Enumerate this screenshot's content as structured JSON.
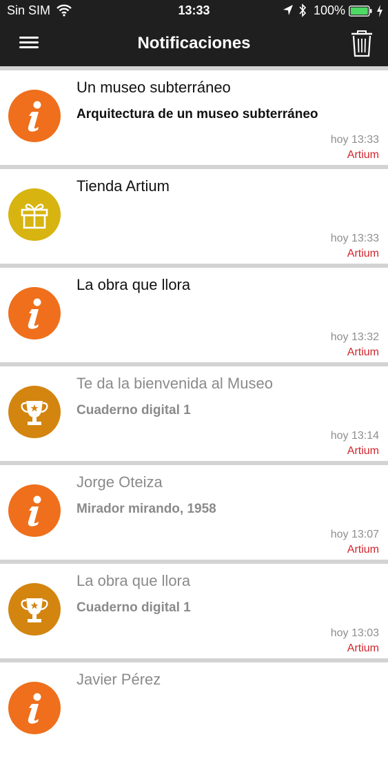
{
  "status_bar": {
    "carrier": "Sin SIM",
    "time": "13:33",
    "battery": "100%"
  },
  "nav_bar": {
    "title": "Notificaciones",
    "menu_icon": "hamburger-menu-icon",
    "trash_icon": "trash-icon"
  },
  "colors": {
    "bar_background": "#1f1f1f",
    "info_orange": "#ef6f1c",
    "gift_yellow": "#d7b40f",
    "trophy_gold": "#d3850f",
    "source_red": "#d0262c",
    "separator": "#d3d3d3"
  },
  "notifications": [
    {
      "icon": "info-icon",
      "title": "Un museo subterráneo",
      "subtitle": "Arquitectura de un museo subterráneo",
      "time": "hoy 13:33",
      "source": "Artium",
      "read": false
    },
    {
      "icon": "gift-icon",
      "title": "Tienda Artium",
      "subtitle": "",
      "time": "hoy 13:33",
      "source": "Artium",
      "read": false
    },
    {
      "icon": "info-icon",
      "title": "La obra que llora",
      "subtitle": "",
      "time": "hoy 13:32",
      "source": "Artium",
      "read": false
    },
    {
      "icon": "trophy-icon",
      "title": "Te da la bienvenida al Museo",
      "subtitle": "Cuaderno digital 1",
      "time": "hoy 13:14",
      "source": "Artium",
      "read": true
    },
    {
      "icon": "info-icon",
      "title": "Jorge Oteiza",
      "subtitle": "Mirador mirando, 1958",
      "time": "hoy 13:07",
      "source": "Artium",
      "read": true
    },
    {
      "icon": "trophy-icon",
      "title": "La obra que llora",
      "subtitle": "Cuaderno digital 1",
      "time": "hoy 13:03",
      "source": "Artium",
      "read": true
    },
    {
      "icon": "info-icon",
      "title": "Javier Pérez",
      "subtitle": "",
      "time": "",
      "source": "",
      "read": true
    }
  ]
}
